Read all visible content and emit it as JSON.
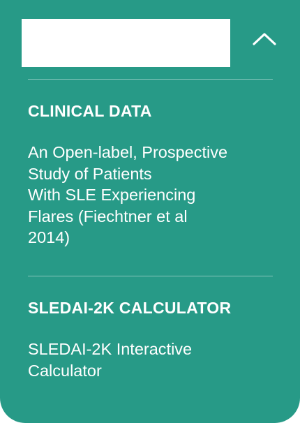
{
  "colors": {
    "panel_background": "#279a87",
    "text": "#ffffff",
    "logo_box": "#ffffff"
  },
  "header": {
    "collapse_icon": "chevron-up-icon"
  },
  "sections": [
    {
      "heading": "CLINICAL DATA",
      "link_lines": [
        "An Open-label, Prospective",
        "Study of Patients",
        "With SLE Experiencing",
        "Flares (Fiechtner et al",
        "2014)"
      ]
    },
    {
      "heading": "SLEDAI-2K CALCULATOR",
      "link_lines": [
        "SLEDAI-2K Interactive",
        "Calculator"
      ]
    }
  ]
}
